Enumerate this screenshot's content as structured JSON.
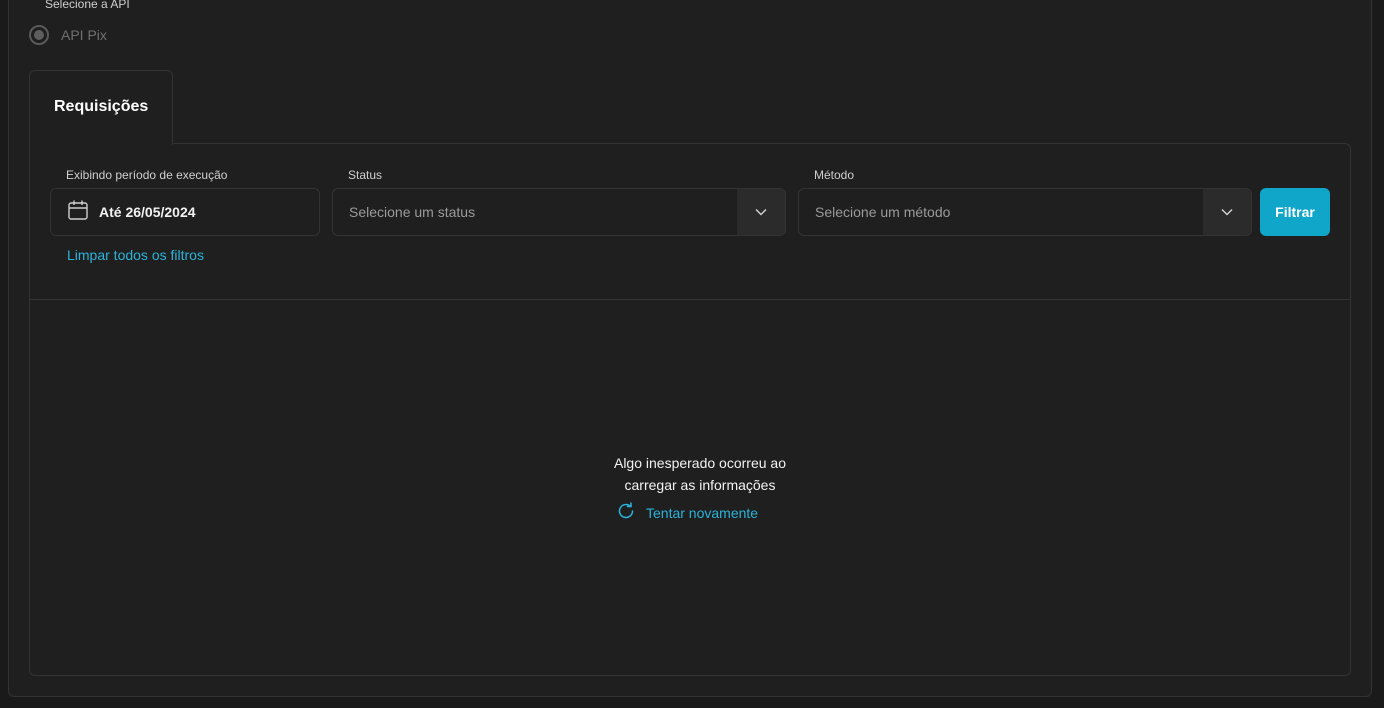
{
  "api_selector": {
    "label": "Selecione a API",
    "options": [
      {
        "label": "API Pix",
        "selected": true
      }
    ]
  },
  "tabs": [
    {
      "label": "Requisições",
      "active": true
    }
  ],
  "filters": {
    "period": {
      "label": "Exibindo período de execução",
      "value": "Até 26/05/2024",
      "icon": "calendar-icon"
    },
    "status": {
      "label": "Status",
      "placeholder": "Selecione um status",
      "icon": "chevron-down-icon"
    },
    "method": {
      "label": "Método",
      "placeholder": "Selecione um método",
      "icon": "chevron-down-icon"
    },
    "submit_label": "Filtrar",
    "clear_label": "Limpar todos os filtros"
  },
  "error": {
    "line1": "Algo inesperado ocorreu ao",
    "line2": "carregar as informações",
    "retry_label": "Tentar novamente",
    "retry_icon": "refresh-icon"
  },
  "colors": {
    "accent": "#0fa6c9",
    "link": "#2bb3d9",
    "background": "#1f1f1f"
  }
}
